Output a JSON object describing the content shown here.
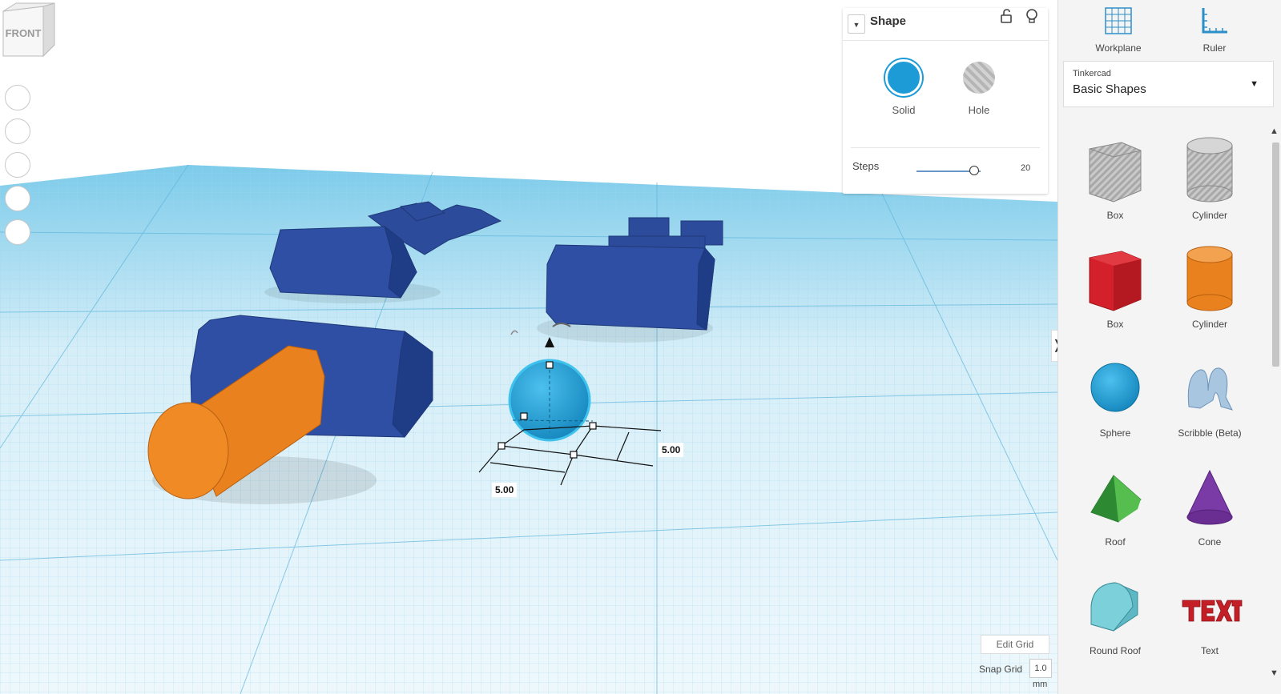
{
  "viewcube": {
    "face_label": "FRONT"
  },
  "view_controls": [
    "home-view",
    "fit-view",
    "zoom-in",
    "zoom-out",
    "ortho-view"
  ],
  "selection": {
    "width_label": "5.00",
    "depth_label": "5.00"
  },
  "inspector": {
    "title": "Shape",
    "modes": [
      {
        "label": "Solid",
        "color": "#1d9bd6",
        "selected": true
      },
      {
        "label": "Hole",
        "color": "#b5b5b5",
        "selected": false
      }
    ],
    "steps": {
      "label": "Steps",
      "value": "20",
      "fraction": 0.82
    }
  },
  "grid_controls": {
    "edit_label": "Edit Grid",
    "snap_label": "Snap Grid",
    "snap_value": "1.0",
    "snap_unit": "mm"
  },
  "tools": [
    {
      "label": "Workplane"
    },
    {
      "label": "Ruler"
    }
  ],
  "library": {
    "source": "Tinkercad",
    "name": "Basic Shapes"
  },
  "shapes": [
    {
      "label": "Box",
      "icon": "box-hole-icon"
    },
    {
      "label": "Cylinder",
      "icon": "cylinder-hole-icon"
    },
    {
      "label": "Box",
      "icon": "box-icon"
    },
    {
      "label": "Cylinder",
      "icon": "cylinder-icon"
    },
    {
      "label": "Sphere",
      "icon": "sphere-icon"
    },
    {
      "label": "Scribble (Beta)",
      "icon": "scribble-icon"
    },
    {
      "label": "Roof",
      "icon": "roof-icon"
    },
    {
      "label": "Cone",
      "icon": "cone-icon"
    },
    {
      "label": "Round Roof",
      "icon": "round-roof-icon"
    },
    {
      "label": "Text",
      "icon": "text-icon"
    }
  ],
  "colors": {
    "accent": "#1d9bd6",
    "navy": "#2d4b9b",
    "orange": "#e8811e",
    "grid": "#7fc8e6"
  }
}
